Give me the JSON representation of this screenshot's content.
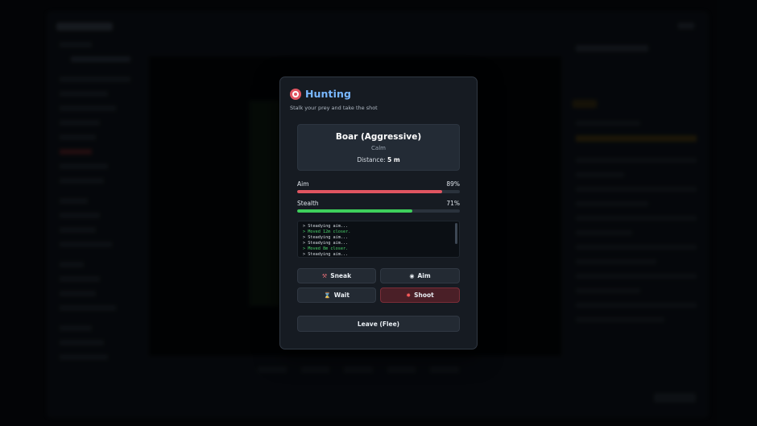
{
  "modal": {
    "title": "Hunting",
    "subtitle": "Stalk your prey and take the shot",
    "icon": "target-icon"
  },
  "animal": {
    "name": "Boar (Aggressive)",
    "state": "Calm",
    "distance_label": "Distance:",
    "distance_value": "5 m"
  },
  "stats": {
    "aim": {
      "label": "Aim",
      "value_text": "89%",
      "value": 89,
      "color": "#e05561"
    },
    "stealth": {
      "label": "Stealth",
      "value_text": "71%",
      "value": 71,
      "color": "#3ecf5b"
    }
  },
  "log": [
    {
      "text": "> Steadying aim...",
      "tone": "normal"
    },
    {
      "text": "> Moved 12m closer.",
      "tone": "green"
    },
    {
      "text": "> Steadying aim...",
      "tone": "normal"
    },
    {
      "text": "> Steadying aim...",
      "tone": "normal"
    },
    {
      "text": "> Moved 8m closer.",
      "tone": "green"
    },
    {
      "text": "> Steadying aim...",
      "tone": "normal"
    },
    {
      "text": "> Steadying aim...",
      "tone": "normal"
    },
    {
      "text": "> Steadying aim...",
      "tone": "normal"
    }
  ],
  "actions": {
    "sneak": {
      "label": "Sneak",
      "icon": "sneak-icon"
    },
    "aim": {
      "label": "Aim",
      "icon": "eye-icon"
    },
    "wait": {
      "label": "Wait",
      "icon": "hourglass-icon"
    },
    "shoot": {
      "label": "Shoot",
      "icon": "shoot-icon"
    },
    "leave": {
      "label": "Leave (Flee)"
    }
  }
}
